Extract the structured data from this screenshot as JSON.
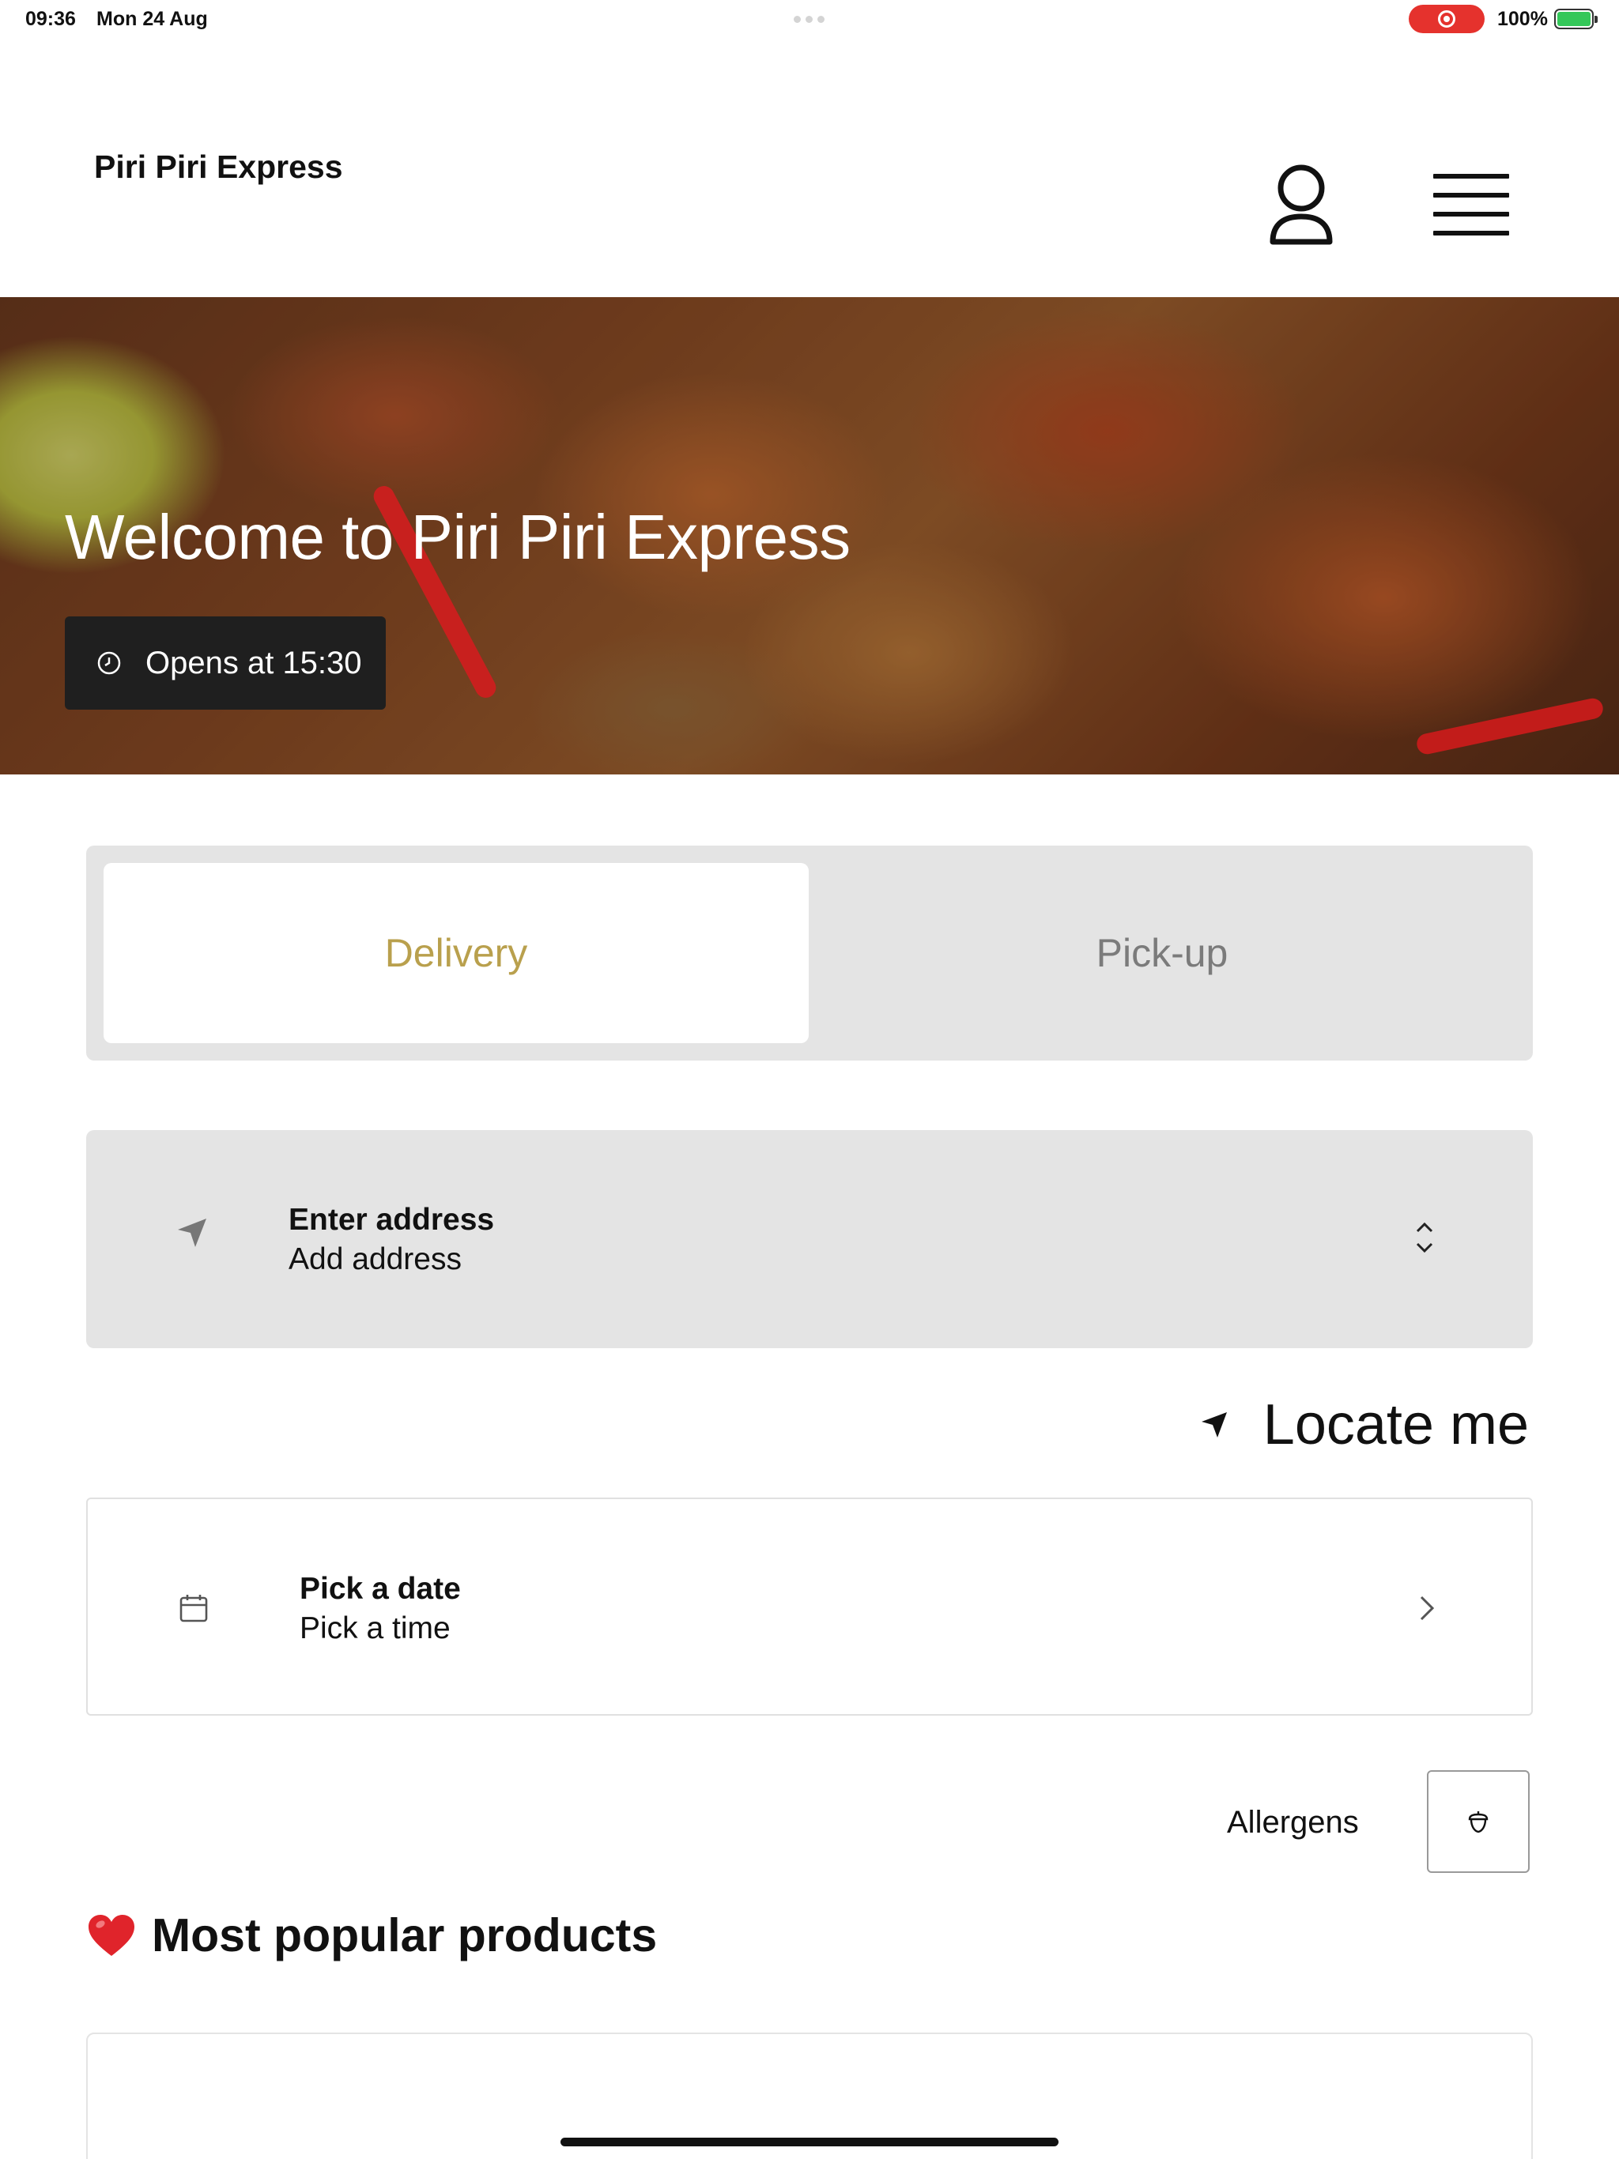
{
  "status_bar": {
    "time": "09:36",
    "date": "Mon 24 Aug",
    "battery": "100%"
  },
  "header": {
    "brand": "Piri Piri Express"
  },
  "hero": {
    "title": "Welcome to Piri Piri Express",
    "opens": "Opens at 15:30"
  },
  "order_mode": {
    "delivery": "Delivery",
    "pickup": "Pick-up",
    "selected": "Delivery",
    "accent_color": "#b9a04d"
  },
  "address": {
    "title": "Enter address",
    "subtitle": "Add address"
  },
  "locate": {
    "label": "Locate me"
  },
  "schedule": {
    "title": "Pick a date",
    "subtitle": "Pick a time"
  },
  "allergens": {
    "label": "Allergens"
  },
  "popular": {
    "emoji": "❤️",
    "title": "Most popular products"
  }
}
